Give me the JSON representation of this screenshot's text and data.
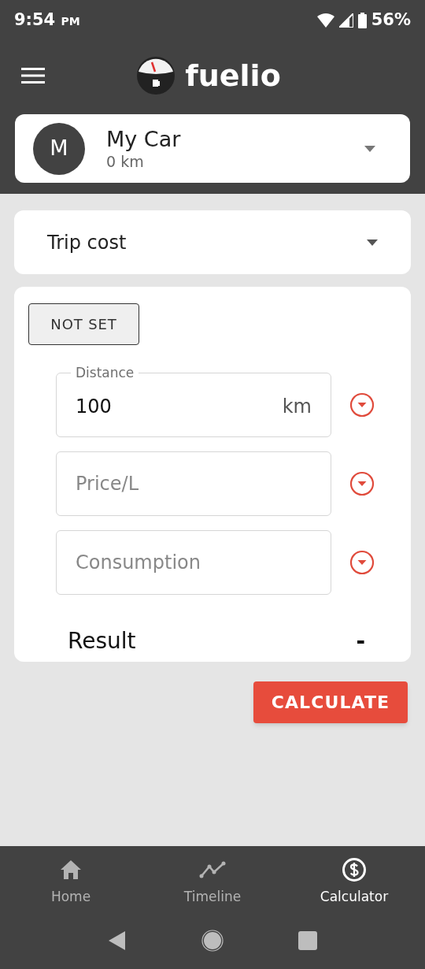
{
  "status_bar": {
    "time": "9:54",
    "ampm": "PM",
    "battery": "56%"
  },
  "app_bar": {
    "title": "fuelio"
  },
  "vehicle": {
    "initial": "M",
    "name": "My Car",
    "odometer": "0 km"
  },
  "calculator_type": {
    "value": "Trip cost"
  },
  "mode_button": "NOT SET",
  "fields": [
    {
      "kind": "value",
      "label": "Distance",
      "value": "100",
      "unit": "km"
    },
    {
      "kind": "placeholder",
      "placeholder": "Price/L"
    },
    {
      "kind": "placeholder",
      "placeholder": "Consumption"
    }
  ],
  "result": {
    "label": "Result",
    "value": "-"
  },
  "calculate_button": "CALCULATE",
  "bottom_nav": [
    {
      "kind": "home",
      "label": "Home",
      "selected": false
    },
    {
      "kind": "timeline",
      "label": "Timeline",
      "selected": false
    },
    {
      "kind": "calculator",
      "label": "Calculator",
      "selected": true
    }
  ]
}
